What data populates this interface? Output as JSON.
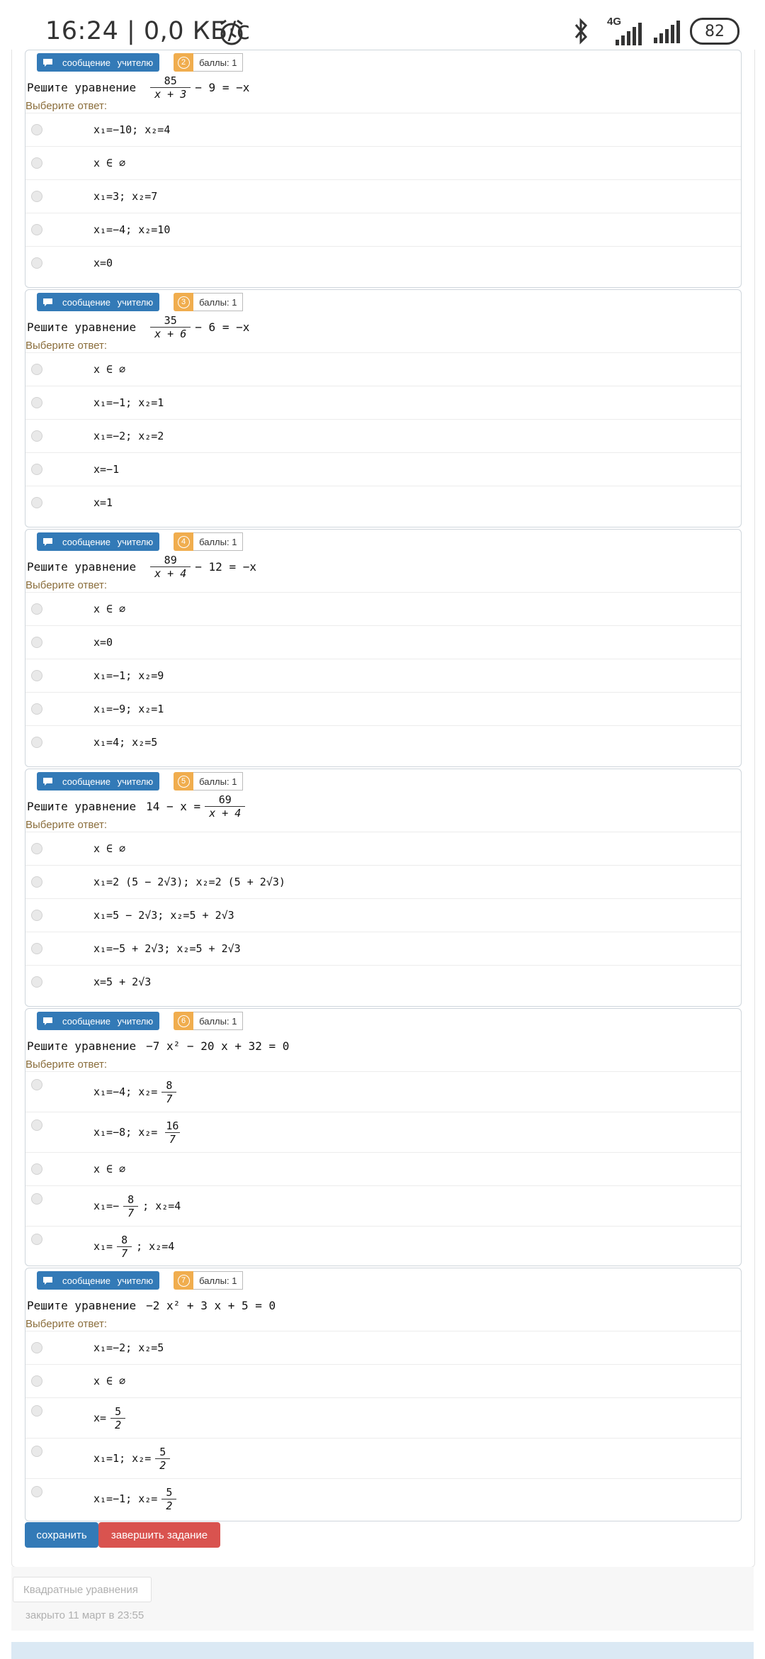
{
  "status_bar": {
    "time": "16:24 | 0,0 КБ/с",
    "network": "4G",
    "battery": "82"
  },
  "labels": {
    "message_teacher": "сообщение учителю",
    "points": "баллы: 1",
    "solve": "Решите уравнение",
    "choose_answer": "Выберите ответ:"
  },
  "questions": [
    {
      "number": "2",
      "eq": {
        "frac_num": "85",
        "frac_den": "x + 3",
        "rest": "− 9 = −x"
      },
      "answers": [
        "x₁=−10; x₂=4",
        "x ∈ ∅",
        "x₁=3; x₂=7",
        "x₁=−4; x₂=10",
        "x=0"
      ]
    },
    {
      "number": "3",
      "eq": {
        "frac_num": "35",
        "frac_den": "x + 6",
        "rest": "− 6 = −x"
      },
      "answers": [
        "x ∈ ∅",
        "x₁=−1; x₂=1",
        "x₁=−2; x₂=2",
        "x=−1",
        "x=1"
      ]
    },
    {
      "number": "4",
      "eq": {
        "frac_num": "89",
        "frac_den": "x + 4",
        "rest": "− 12 = −x"
      },
      "answers": [
        "x ∈ ∅",
        "x=0",
        "x₁=−1; x₂=9",
        "x₁=−9; x₂=1",
        "x₁=4; x₂=5"
      ]
    },
    {
      "number": "5",
      "eq": {
        "prefix": "14 − x =",
        "frac_num": "69",
        "frac_den": "x + 4"
      },
      "answers": [
        "x ∈ ∅",
        "x₁=2 (5 − 2√3); x₂=2 (5 + 2√3)",
        "x₁=5 − 2√3; x₂=5 + 2√3",
        "x₁=−5 + 2√3; x₂=5 + 2√3",
        "x=5 + 2√3"
      ]
    },
    {
      "number": "6",
      "eq": {
        "text": "−7 x² − 20 x + 32 = 0"
      },
      "answers": [
        {
          "pre": "x₁=−4; x₂=",
          "fn": "8",
          "fd": "7",
          "post": ""
        },
        {
          "pre": "x₁=−8; x₂=",
          "fn": "16",
          "fd": "7",
          "post": ""
        },
        {
          "text": "x ∈ ∅"
        },
        {
          "pre": "x₁=−",
          "fn": "8",
          "fd": "7",
          "post": "; x₂=4"
        },
        {
          "pre": "x₁=",
          "fn": "8",
          "fd": "7",
          "post": "; x₂=4"
        }
      ]
    },
    {
      "number": "7",
      "eq": {
        "text": "−2 x² + 3 x + 5 = 0"
      },
      "answers": [
        {
          "text": "x₁=−2; x₂=5"
        },
        {
          "text": "x ∈ ∅"
        },
        {
          "pre": "x=",
          "fn": "5",
          "fd": "2",
          "post": ""
        },
        {
          "pre": "x₁=1; x₂=",
          "fn": "5",
          "fd": "2",
          "post": ""
        },
        {
          "pre": "x₁=−1; x₂=",
          "fn": "5",
          "fd": "2",
          "post": ""
        }
      ]
    }
  ],
  "actions": {
    "save": "сохранить",
    "finish": "завершить задание"
  },
  "footer": {
    "tab": "Квадратные уравнения",
    "closed": "закрыто 11 март в 23:55"
  }
}
